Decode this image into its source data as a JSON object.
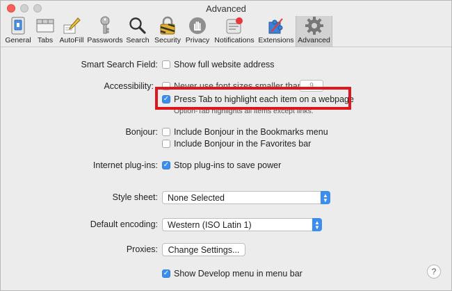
{
  "window": {
    "title": "Advanced"
  },
  "toolbar": {
    "items": [
      {
        "label": "General",
        "icon": "general-icon"
      },
      {
        "label": "Tabs",
        "icon": "tabs-icon"
      },
      {
        "label": "AutoFill",
        "icon": "pencil-icon"
      },
      {
        "label": "Passwords",
        "icon": "key-icon"
      },
      {
        "label": "Search",
        "icon": "search-icon"
      },
      {
        "label": "Security",
        "icon": "lock-icon"
      },
      {
        "label": "Privacy",
        "icon": "hand-icon"
      },
      {
        "label": "Notifications",
        "icon": "notification-icon"
      },
      {
        "label": "Extensions",
        "icon": "puzzle-icon"
      },
      {
        "label": "Advanced",
        "icon": "gear-icon"
      }
    ],
    "active": "Advanced"
  },
  "settings": {
    "smart_search": {
      "label": "Smart Search Field:",
      "option": "Show full website address",
      "checked": false
    },
    "accessibility": {
      "label": "Accessibility:",
      "option_obscured": "Never use font sizes smaller than",
      "font_size": "9",
      "tab_option": "Press Tab to highlight each item on a webpage",
      "tab_checked": true,
      "tab_hint": "Option-Tab highlights all items except links."
    },
    "bonjour": {
      "label": "Bonjour:",
      "bookmarks": "Include Bonjour in the Bookmarks menu",
      "favorites": "Include Bonjour in the Favorites bar"
    },
    "plugins": {
      "label": "Internet plug-ins:",
      "option": "Stop plug-ins to save power",
      "checked": true
    },
    "style_sheet": {
      "label": "Style sheet:",
      "value": "None Selected"
    },
    "encoding": {
      "label": "Default encoding:",
      "value": "Western (ISO Latin 1)"
    },
    "proxies": {
      "label": "Proxies:",
      "button": "Change Settings..."
    },
    "develop": {
      "option": "Show Develop menu in menu bar",
      "checked": true
    }
  },
  "help": {
    "label": "?"
  },
  "colors": {
    "highlight": "#e0161e",
    "accent": "#3b8ef0"
  }
}
